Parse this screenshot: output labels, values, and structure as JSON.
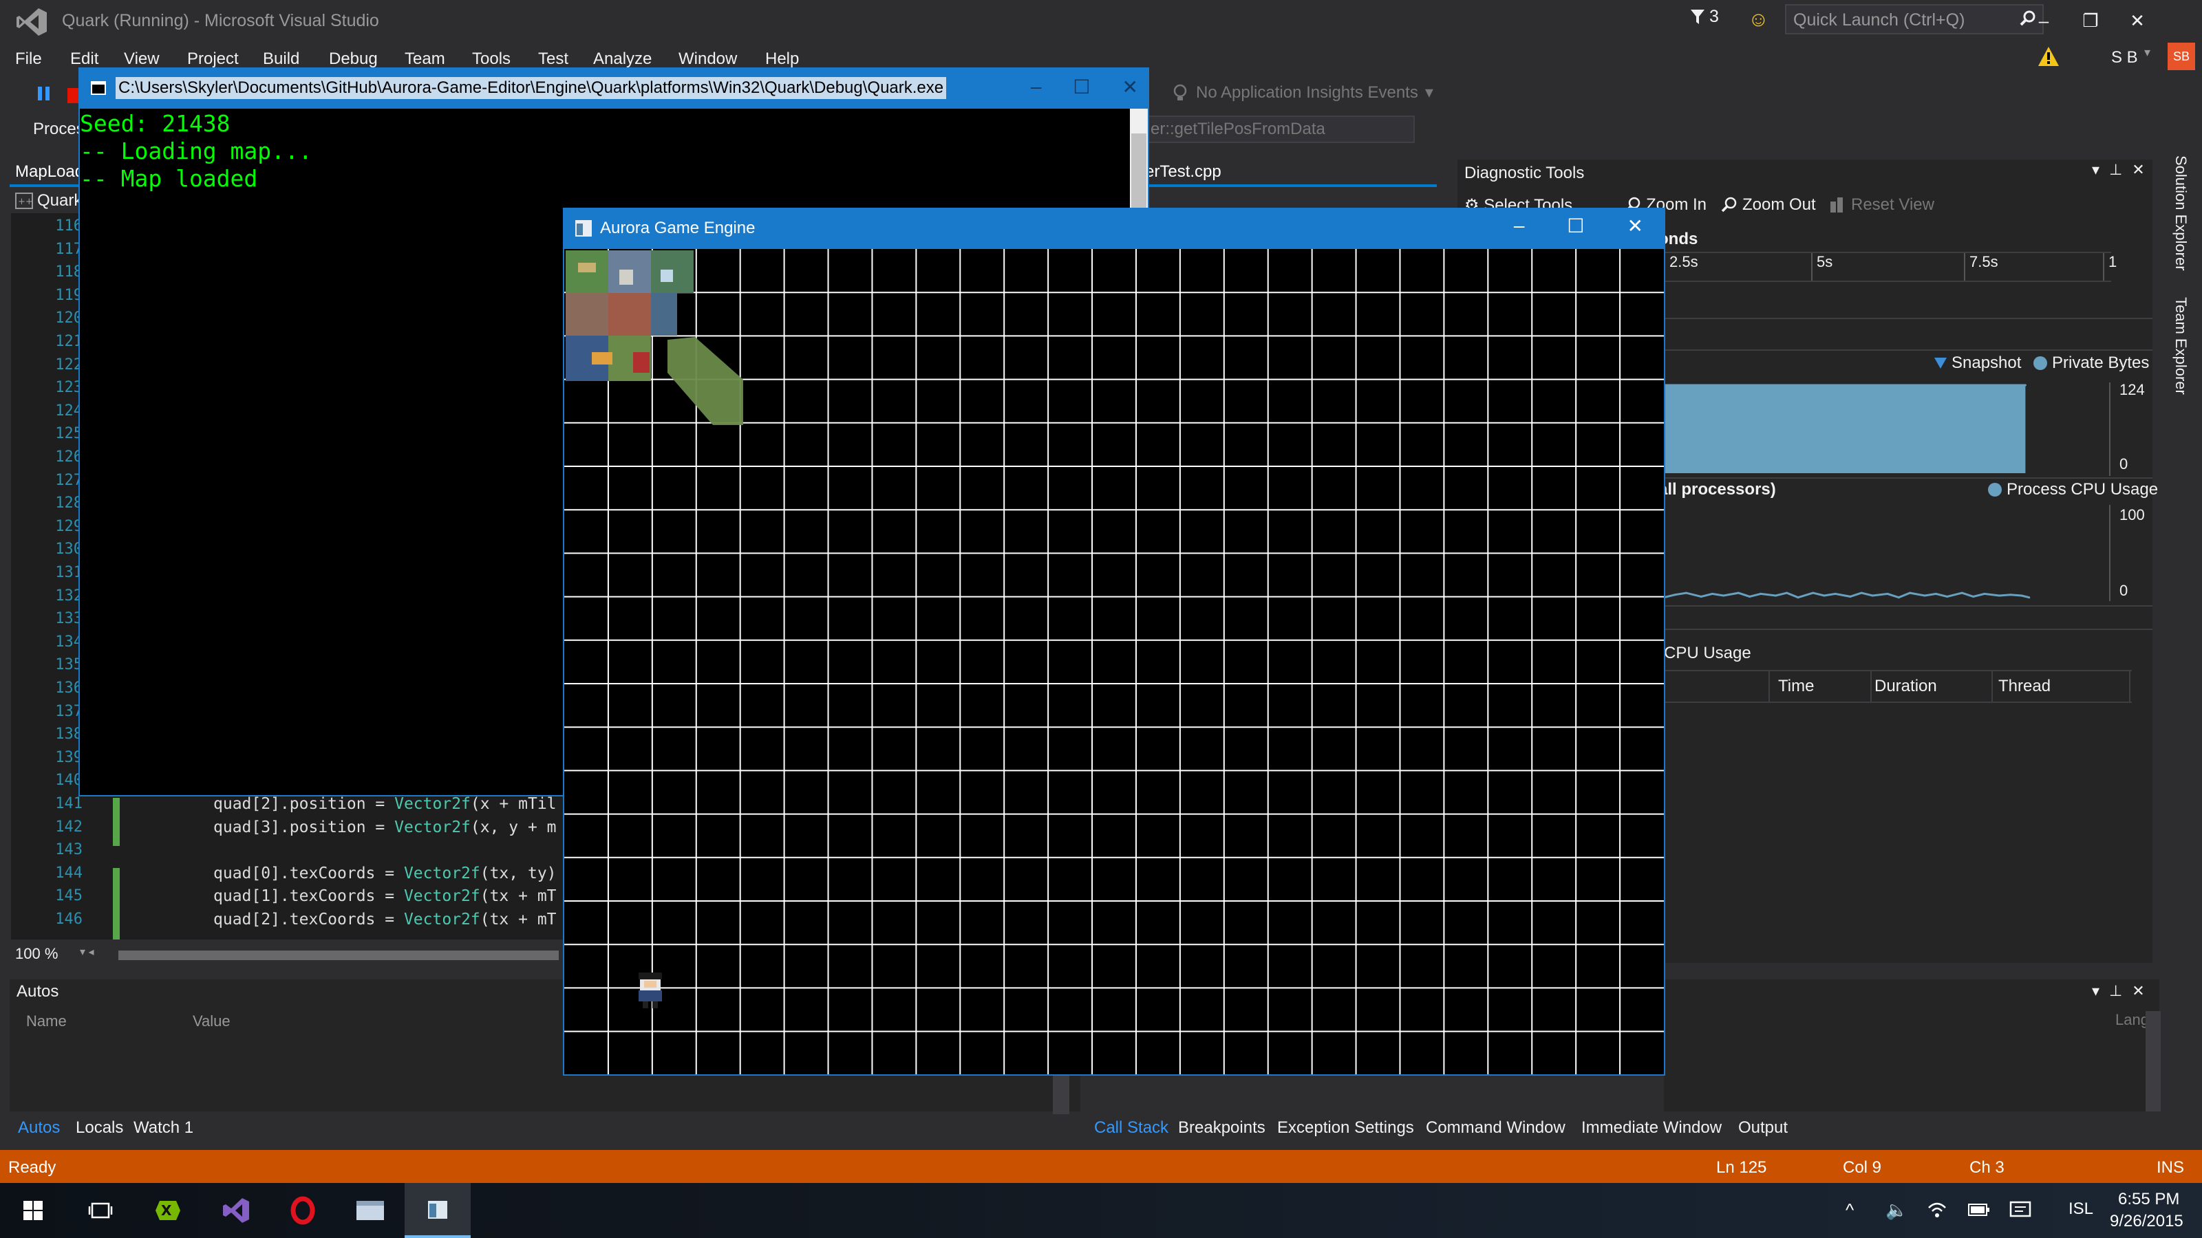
{
  "window": {
    "title": "Quark (Running) - Microsoft Visual Studio",
    "notification_count": "3",
    "quick_launch_placeholder": "Quick Launch (Ctrl+Q)",
    "user_initials": "S B",
    "user_avatar": "SB"
  },
  "menu": [
    "File",
    "Edit",
    "View",
    "Project",
    "Build",
    "Debug",
    "Team",
    "Tools",
    "Test",
    "Analyze",
    "Window",
    "Help"
  ],
  "toolbar": {
    "app_insights": "No Application Insights Events",
    "process_label": "Proces",
    "nav_combo": "er::getTilePosFromData",
    "file_tab": "erTest.cpp"
  },
  "editor": {
    "tab": "MapLoad",
    "project_combo": "Quark",
    "line_numbers": [
      "116",
      "117",
      "118",
      "119",
      "120",
      "121",
      "122",
      "123",
      "124",
      "125",
      "126",
      "127",
      "128",
      "129",
      "130",
      "131",
      "132",
      "133",
      "134",
      "135",
      "136",
      "137",
      "138",
      "139",
      "140",
      "141",
      "142",
      "143",
      "144",
      "145",
      "146"
    ],
    "visible_code": [
      {
        "line": "141",
        "pre": "quad[2].position = ",
        "type": "Vector2f",
        "post": "(x + mTil"
      },
      {
        "line": "142",
        "pre": "quad[3].position = ",
        "type": "Vector2f",
        "post": "(x, y + m"
      },
      {
        "line": "143",
        "pre": "",
        "type": "",
        "post": ""
      },
      {
        "line": "144",
        "pre": "quad[0].texCoords = ",
        "type": "Vector2f",
        "post": "(tx, ty)"
      },
      {
        "line": "145",
        "pre": "quad[1].texCoords = ",
        "type": "Vector2f",
        "post": "(tx + mT"
      },
      {
        "line": "146",
        "pre": "quad[2].texCoords = ",
        "type": "Vector2f",
        "post": "(tx + mT"
      }
    ],
    "zoom": "100 %"
  },
  "autos": {
    "title": "Autos",
    "col_name": "Name",
    "col_value": "Value",
    "tabs": [
      "Autos",
      "Locals",
      "Watch 1"
    ]
  },
  "diagnostics": {
    "title": "Diagnostic Tools",
    "select_tools": "Select Tools",
    "zoom_in": "Zoom In",
    "zoom_out": "Zoom Out",
    "reset_view": "Reset View",
    "seconds_label": "onds",
    "ruler_ticks": [
      "2.5s",
      "5s",
      "7.5s",
      "1"
    ],
    "memory_legend": [
      "Snapshot",
      "Private Bytes"
    ],
    "cpu_section": "all processors)",
    "cpu_legend": "Process CPU Usage",
    "cpu_usage_label": "CPU Usage",
    "columns": [
      "Time",
      "Duration",
      "Thread"
    ],
    "colors": {
      "memory_fill": "#68a0c0",
      "cpu_line": "#68a0c0",
      "snapshot": "#3c8fd8",
      "private_bytes": "#68a0c0"
    }
  },
  "chart_data": [
    {
      "type": "area",
      "ylim": [
        0,
        124
      ],
      "y_ticks": [
        "124",
        "0"
      ],
      "series": [
        {
          "name": "Private Bytes",
          "x": [
            0.0,
            1.0,
            2.0,
            3.0,
            4.0,
            5.0,
            6.0,
            7.0,
            8.0,
            9.0,
            9.7
          ],
          "values": [
            124,
            124,
            124,
            124,
            124,
            124,
            124,
            124,
            124,
            124,
            124
          ]
        }
      ]
    },
    {
      "type": "line",
      "ylim": [
        0,
        100
      ],
      "y_ticks": [
        "100",
        "0"
      ],
      "series": [
        {
          "name": "Process CPU Usage",
          "x": [
            0.0,
            0.3,
            0.6,
            1.0,
            1.3,
            1.6,
            2.0,
            2.3,
            2.6,
            3.0,
            3.3,
            3.6,
            4.0,
            4.3,
            4.6,
            5.0,
            5.3,
            5.6,
            6.0,
            6.3,
            6.6,
            7.0,
            7.3,
            7.6,
            8.0,
            8.3,
            8.6,
            9.0,
            9.3,
            9.6,
            9.8
          ],
          "values": [
            1,
            4,
            6,
            2,
            5,
            3,
            6,
            2,
            5,
            3,
            6,
            1,
            6,
            3,
            5,
            2,
            6,
            3,
            5,
            1,
            6,
            3,
            5,
            2,
            6,
            2,
            5,
            3,
            4,
            3,
            1
          ]
        }
      ]
    }
  ],
  "vertical_tabs": [
    "Solution Explorer",
    "Team Explorer"
  ],
  "callstack": {
    "lang_label": "Lang",
    "tabs": [
      "Call Stack",
      "Breakpoints",
      "Exception Settings",
      "Command Window",
      "Immediate Window",
      "Output"
    ]
  },
  "status": {
    "ready": "Ready",
    "line": "Ln 125",
    "col": "Col 9",
    "ch": "Ch 3",
    "mode": "INS",
    "color": "#ca5100"
  },
  "console": {
    "path": "C:\\Users\\Skyler\\Documents\\GitHub\\Aurora-Game-Editor\\Engine\\Quark\\platforms\\Win32\\Quark\\Debug\\Quark.exe",
    "lines": [
      "Seed: 21438",
      "-- Loading map...",
      "-- Map loaded"
    ],
    "text_color": "#00ff00"
  },
  "game": {
    "title": "Aurora Game Engine",
    "grid_cols": 25,
    "grid_rows": 19,
    "grid_color": "#ffffff"
  },
  "taskbar": {
    "apps": [
      "start-icon",
      "task-view-icon",
      "xamarin-icon",
      "visual-studio-icon",
      "opera-icon",
      "explorer-icon",
      "game-window-icon"
    ],
    "language": "ISL",
    "time": "6:55 PM",
    "date": "9/26/2015"
  }
}
